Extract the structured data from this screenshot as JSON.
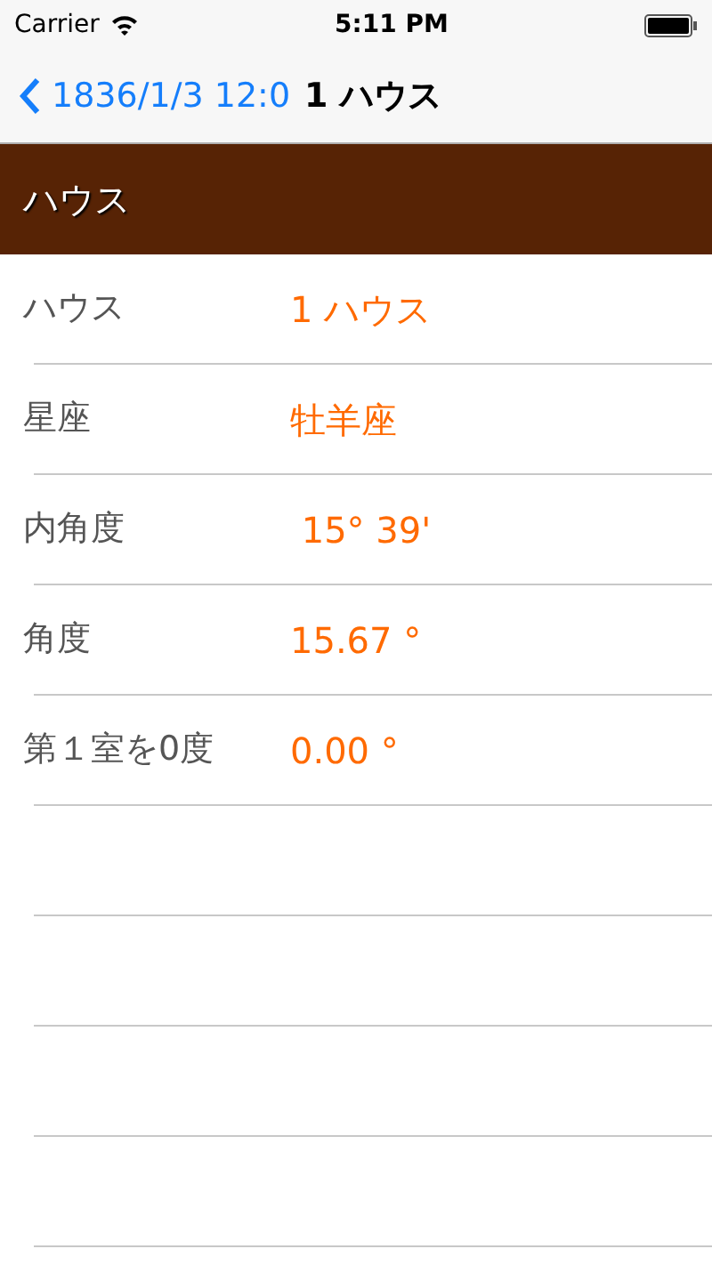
{
  "status_bar": {
    "carrier": "Carrier",
    "time": "5:11 PM"
  },
  "nav": {
    "back": "1836/1/3 12:0",
    "title": "1 ハウス"
  },
  "section": {
    "title": "ハウス"
  },
  "rows": [
    {
      "label": "ハウス",
      "value": "1 ハウス"
    },
    {
      "label": "星座",
      "value": "牡羊座"
    },
    {
      "label": "内角度",
      "value": " 15° 39'"
    },
    {
      "label": "角度",
      "value": "15.67 °"
    },
    {
      "label": "第１室を0度",
      "value": "0.00 °"
    }
  ]
}
